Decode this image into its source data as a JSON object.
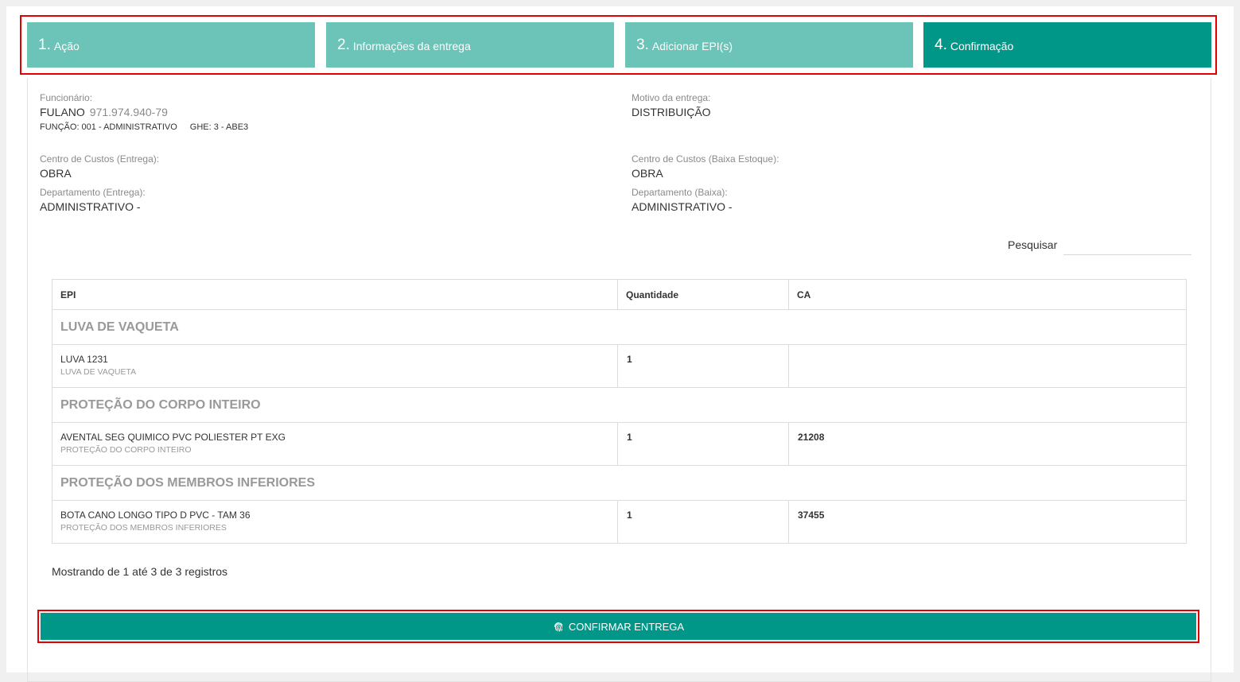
{
  "steps": [
    {
      "num": "1.",
      "label": "Ação"
    },
    {
      "num": "2.",
      "label": "Informações da entrega"
    },
    {
      "num": "3.",
      "label": "Adicionar EPI(s)"
    },
    {
      "num": "4.",
      "label": "Confirmação"
    }
  ],
  "employee": {
    "label": "Funcionário:",
    "name": "FULANO",
    "document": "971.974.940-79",
    "function": "FUNÇÃO: 001 - ADMINISTRATIVO",
    "ghe": "GHE: 3 - ABE3"
  },
  "reason": {
    "label": "Motivo da entrega:",
    "value": "DISTRIBUIÇÃO"
  },
  "cost_center_delivery": {
    "label": "Centro de Custos (Entrega):",
    "value": "OBRA"
  },
  "cost_center_stock": {
    "label": "Centro de Custos (Baixa Estoque):",
    "value": "OBRA"
  },
  "department_delivery": {
    "label": "Departamento (Entrega):",
    "value": "ADMINISTRATIVO -"
  },
  "department_low": {
    "label": "Departamento (Baixa):",
    "value": "ADMINISTRATIVO -"
  },
  "search": {
    "label": "Pesquisar",
    "value": ""
  },
  "table": {
    "headers": {
      "epi": "EPI",
      "quantity": "Quantidade",
      "ca": "CA"
    },
    "groups": [
      {
        "title": "LUVA DE VAQUETA",
        "item": {
          "name": "LUVA 1231",
          "category": "LUVA DE VAQUETA",
          "quantity": "1",
          "ca": ""
        }
      },
      {
        "title": "PROTEÇÃO DO CORPO INTEIRO",
        "item": {
          "name": "AVENTAL SEG QUIMICO PVC POLIESTER PT EXG",
          "category": "PROTEÇÃO DO CORPO INTEIRO",
          "quantity": "1",
          "ca": "21208"
        }
      },
      {
        "title": "PROTEÇÃO DOS MEMBROS INFERIORES",
        "item": {
          "name": "BOTA CANO LONGO TIPO D PVC - TAM 36",
          "category": "PROTEÇÃO DOS MEMBROS INFERIORES",
          "quantity": "1",
          "ca": "37455"
        }
      }
    ]
  },
  "records_info": "Mostrando de 1 até 3 de 3 registros",
  "confirm_button": {
    "label": "CONFIRMAR ENTREGA",
    "icon": "fingerprint-icon"
  },
  "colors": {
    "step_inactive": "#6cc3b7",
    "step_active": "#009688",
    "highlight": "#e30000"
  }
}
